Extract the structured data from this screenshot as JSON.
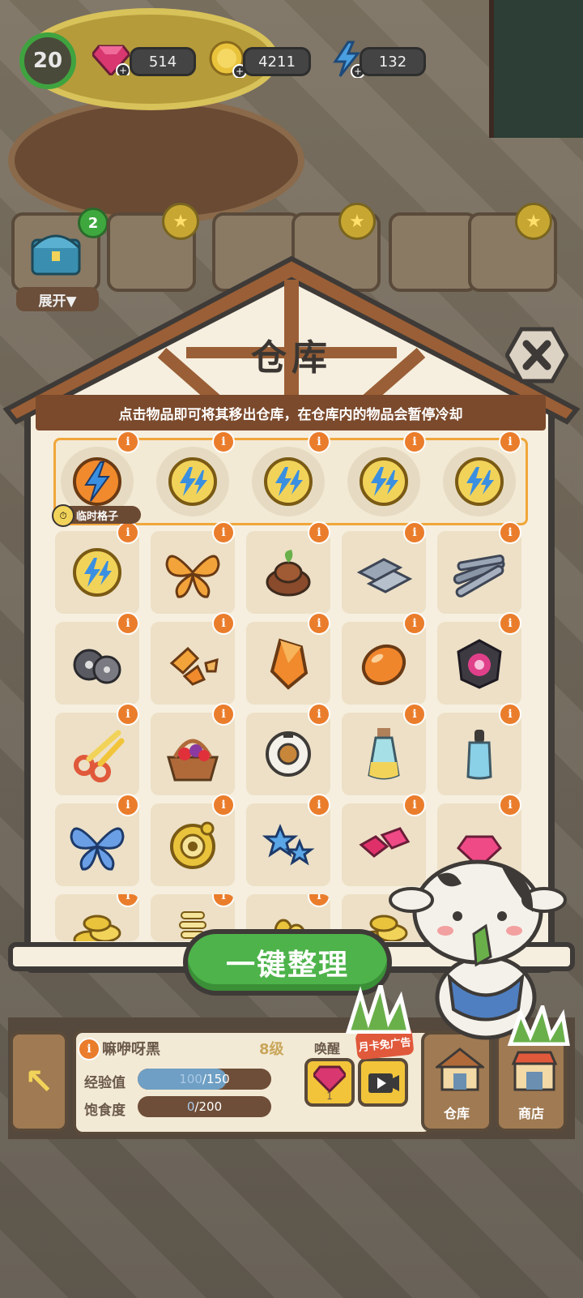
{
  "hud": {
    "level": "20",
    "gems": "514",
    "coins": "4211",
    "energy": "132",
    "tray_expand_label": "展开▼",
    "tray_badge_count": "2"
  },
  "dialog": {
    "title": "仓库",
    "subtitle": "点击物品即可将其移出仓库，在仓库内的物品会暂停冷却",
    "temp_slot_label": "临时格子",
    "organize_button": "一键整理",
    "temp_items": [
      "energy-orb-orange",
      "energy-orb-yellow",
      "energy-orb-yellow",
      "energy-orb-yellow",
      "energy-orb-yellow"
    ],
    "items": [
      [
        "energy-orb-yellow",
        "orange-butterfly",
        "cocoa-pile",
        "metal-plates",
        "iron-rods"
      ],
      [
        "thread-spools",
        "orange-shards",
        "amber-crystal",
        "amber-gem",
        "camera-lens"
      ],
      [
        "scissors",
        "fruit-basket",
        "donut-ring",
        "potion-bottle",
        "dropper-bottle"
      ],
      [
        "blue-butterfly",
        "gold-medal-badge",
        "blue-stars",
        "pink-gems",
        "pink-gem"
      ],
      [
        "gold-coins",
        "spring-coil",
        "gold-nuggets",
        "gold-coins",
        ""
      ]
    ],
    "info_glyph": "i"
  },
  "pet": {
    "name": "嘛咿呀黑",
    "level": "8级",
    "exp_label": "经验值",
    "exp_current": "100",
    "exp_max": "/150",
    "exp_fraction": 0.667,
    "hunger_label": "饱食度",
    "hunger_current": "0",
    "hunger_max": "/200",
    "hunger_fraction": 0,
    "wake_label": "唤醒",
    "wake_gem_cost": "1",
    "ad_tag": "月卡免广告"
  },
  "nav": {
    "warehouse": "仓库",
    "shop": "商店"
  },
  "colors": {
    "accent_green": "#4db34a",
    "info_orange": "#ea7d2c",
    "roof_brown": "#7b4a2c",
    "temp_border": "#f0a63a"
  }
}
